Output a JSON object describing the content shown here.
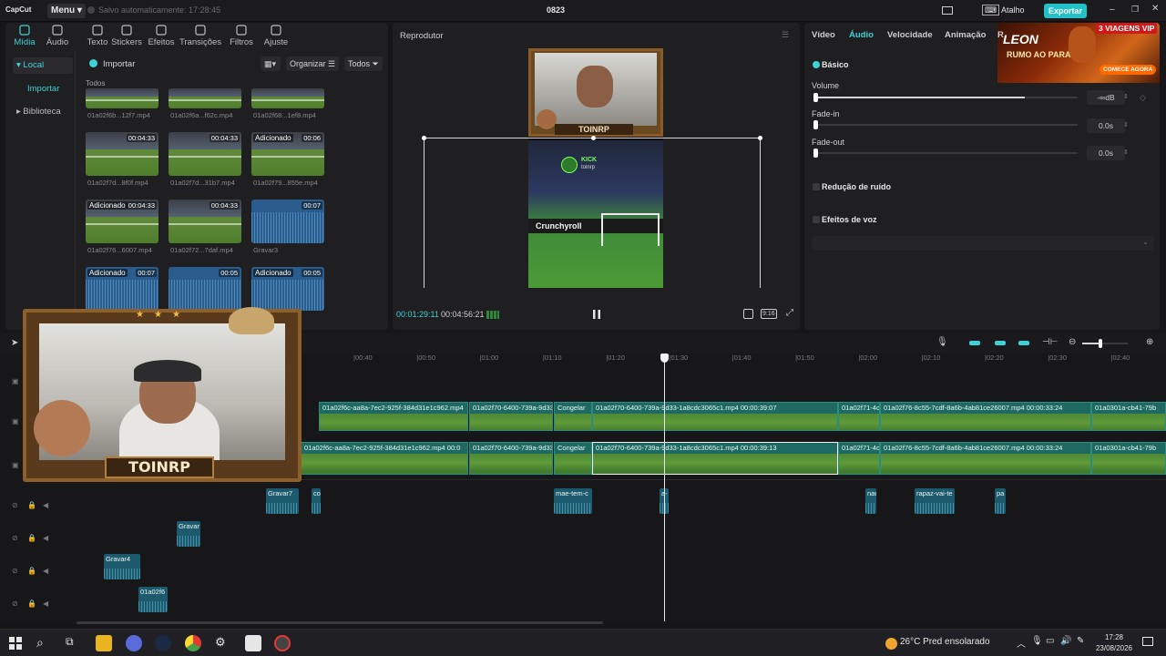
{
  "app": {
    "logo": "CapCut",
    "menu_label": "Menu",
    "saved_text": "Salvo automaticamente: 17:28:45",
    "project_title": "0823",
    "shortcuts_label": "Atalho",
    "export_label": "Exportar"
  },
  "media_tabs": [
    {
      "label": "Mídia",
      "icon": "media-icon"
    },
    {
      "label": "Áudio",
      "icon": "audio-icon"
    },
    {
      "label": "Texto",
      "icon": "text-icon"
    },
    {
      "label": "Stickers",
      "icon": "sticker-icon"
    },
    {
      "label": "Efeitos",
      "icon": "effects-icon"
    },
    {
      "label": "Transições",
      "icon": "transitions-icon"
    },
    {
      "label": "Filtros",
      "icon": "filters-icon"
    },
    {
      "label": "Ajuste",
      "icon": "adjust-icon"
    }
  ],
  "side_nav": [
    {
      "label": "▾ Local"
    },
    {
      "label": "Importar"
    },
    {
      "label": "▸ Biblioteca"
    }
  ],
  "media": {
    "import_label": "Importar",
    "organize_label": "Organizar",
    "filter_label": "Todos",
    "section_label": "Todos",
    "items": [
      {
        "name": "01a02f6b...12f7.mp4",
        "type": "video",
        "badge": "",
        "duration": ""
      },
      {
        "name": "01a02f6a...f62c.mp4",
        "type": "video",
        "badge": "",
        "duration": ""
      },
      {
        "name": "01a02f68...1ef8.mp4",
        "type": "video",
        "badge": "",
        "duration": ""
      },
      {
        "name": "01a02f7d...8f0f.mp4",
        "type": "video",
        "badge": "",
        "duration": "00:04:33"
      },
      {
        "name": "01a02f7d...31b7.mp4",
        "type": "video",
        "badge": "",
        "duration": "00:04:33"
      },
      {
        "name": "01a02f79...855e.mp4",
        "type": "video",
        "badge": "Adicionado",
        "duration": "00:06"
      },
      {
        "name": "01a02f76...6007.mp4",
        "type": "video",
        "badge": "Adicionado",
        "duration": "00:04:33"
      },
      {
        "name": "01a02f72...7daf.mp4",
        "type": "video",
        "badge": "",
        "duration": "00:04:33"
      },
      {
        "name": "Gravar3",
        "type": "audio",
        "badge": "",
        "duration": "00:07"
      },
      {
        "name": "",
        "type": "audio",
        "badge": "Adicionado",
        "duration": "00:07"
      },
      {
        "name": "",
        "type": "audio",
        "badge": "",
        "duration": "00:05"
      },
      {
        "name": "",
        "type": "audio",
        "badge": "Adicionado",
        "duration": "00:05"
      }
    ]
  },
  "player": {
    "title": "Reprodutor",
    "current_time": "00:01:29:11",
    "total_time": "00:04:56:21",
    "ratio_label": "9:16",
    "overlay_name": "TOINRP",
    "kick_label": "KICK",
    "kick_user": "toinrp",
    "sponsor_banner": "Crunchyroll"
  },
  "inspector": {
    "tabs": [
      "Vídeo",
      "Áudio",
      "Velocidade",
      "Animação",
      "R"
    ],
    "active_tab": "Áudio",
    "section": "Básico",
    "volume": {
      "label": "Volume",
      "value": "-∞dB",
      "level": 0.8
    },
    "fade_in": {
      "label": "Fade-in",
      "value": "0.0s"
    },
    "fade_out": {
      "label": "Fade-out",
      "value": "0.0s"
    },
    "noise_reduction": "Redução de ruído",
    "voice_effects": "Efeitos de voz"
  },
  "ad": {
    "brand": "LEON",
    "tag": "3 VIAGENS VIP",
    "headline": "RUMO AO PARAÍSO",
    "cta": "COMECE AGORA"
  },
  "timeline": {
    "ruler": [
      "00:40",
      "00:50",
      "01:00",
      "01:10",
      "01:20",
      "01:30",
      "01:40",
      "01:50",
      "02:00",
      "02:10",
      "02:20",
      "02:30",
      "02:40"
    ],
    "overlay_track": [
      {
        "label": "01a02f6c-aa8a-7ec2-925f-384d31e1c962.mp4"
      },
      {
        "label": "01a02f70-6400-739a-9d33"
      },
      {
        "label": "Congelar"
      },
      {
        "label": "01a02f70-6400-739a-9d33-1a8cdc3065c1.mp4   00:00:39:07"
      },
      {
        "label": "01a02f71-4c"
      },
      {
        "label": "01a02f76-8c55-7cdf-8a6b-4ab81ce26007.mp4   00:00:33:24"
      },
      {
        "label": "01a0301a-cb41-79b"
      }
    ],
    "main_track": [
      {
        "label": "01a02f6c-aa8a-7ec2-925f-384d31e1c962.mp4   00:0"
      },
      {
        "label": "01a02f70-6400-739a-9d33"
      },
      {
        "label": "Congelar"
      },
      {
        "label": "01a02f70-6400-739a-9d33-1a8cdc3065c1.mp4   00:00:39:13"
      },
      {
        "label": "01a02f71-4c"
      },
      {
        "label": "01a02f76-8c55-7cdf-8a6b-4ab81ce26007.mp4   00:00:33:24"
      },
      {
        "label": "01a0301a-cb41-79b"
      }
    ],
    "audio1": [
      {
        "label": "Gravar7"
      },
      {
        "label": "co"
      },
      {
        "label": "mae-tem-c"
      },
      {
        "label": "a-"
      },
      {
        "label": "nao"
      },
      {
        "label": "rapaz-vai-te"
      },
      {
        "label": "pa"
      }
    ],
    "audio2": [
      {
        "label": "Gravar"
      }
    ],
    "audio3": [
      {
        "label": "Gravar4"
      }
    ],
    "audio4": [
      {
        "label": "01a02f6"
      }
    ]
  },
  "webcam": {
    "name": "TOINRP"
  },
  "taskbar": {
    "weather": "26°C  Pred ensolarado",
    "time": "17:28",
    "date": "23/08/2026"
  }
}
